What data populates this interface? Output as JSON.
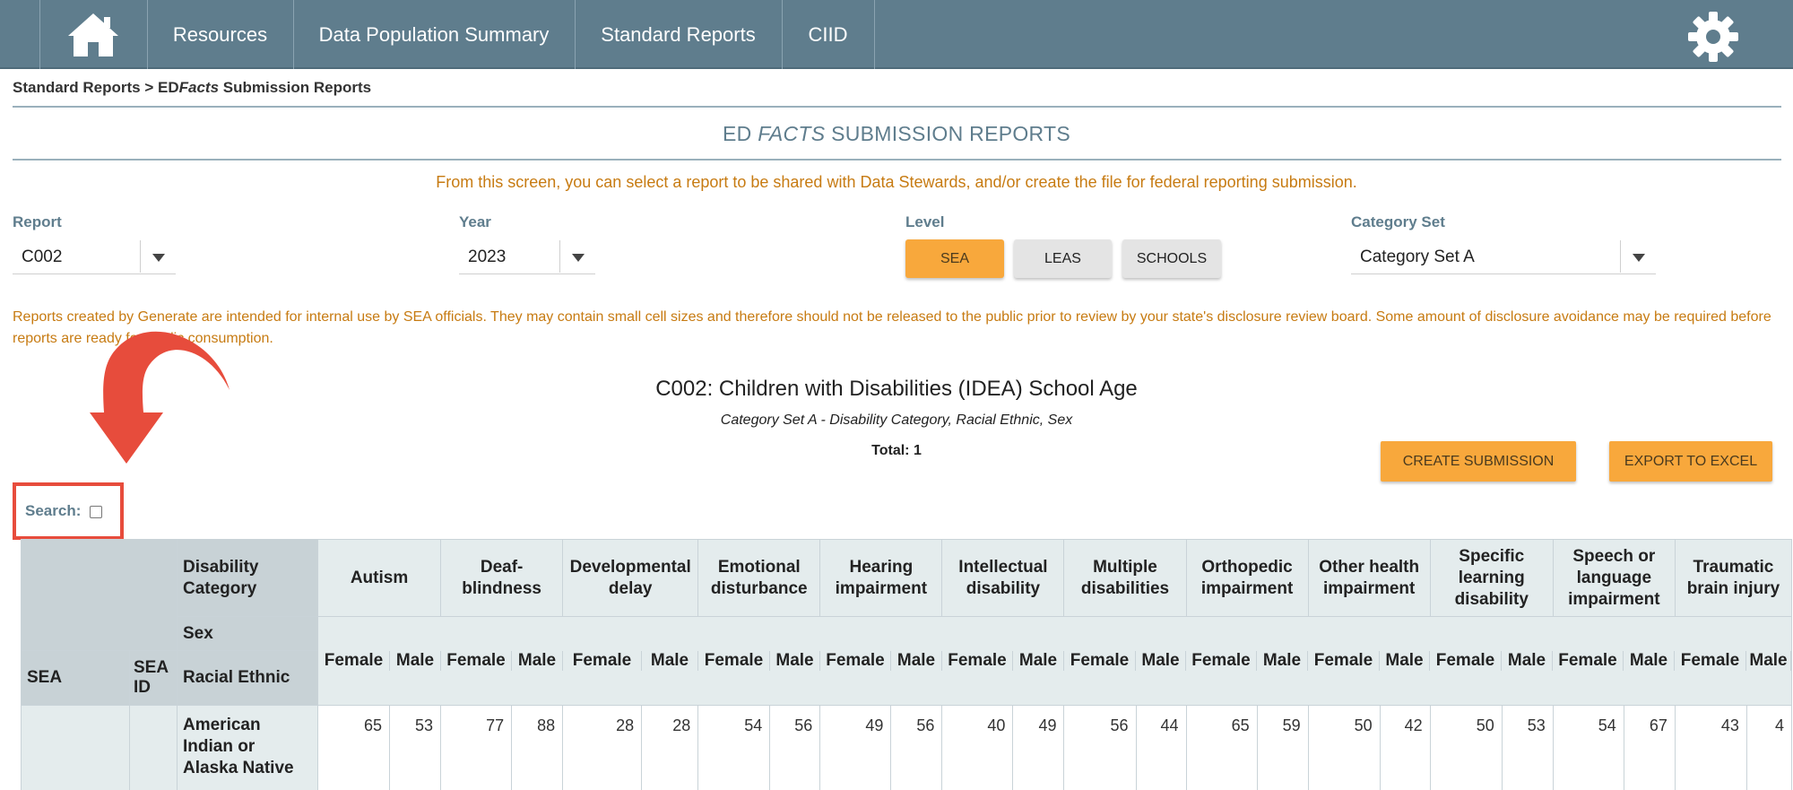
{
  "nav": {
    "items": [
      "Resources",
      "Data Population Summary",
      "Standard Reports",
      "CIID"
    ],
    "home_icon": "home-icon",
    "settings_icon": "gear-icon"
  },
  "breadcrumb": {
    "prefix": "Standard Reports > ED",
    "italic": "Facts",
    "suffix": " Submission Reports"
  },
  "page_title": {
    "prefix": "ED ",
    "italic": "FACTS",
    "suffix": " SUBMISSION REPORTS"
  },
  "intro_text": "From this screen, you can select a report to be shared with Data Stewards, and/or create the file for federal reporting submission.",
  "filters": {
    "report_label": "Report",
    "report_value": "C002",
    "year_label": "Year",
    "year_value": "2023",
    "level_label": "Level",
    "levels": [
      "SEA",
      "LEAS",
      "SCHOOLS"
    ],
    "level_selected": "SEA",
    "category_set_label": "Category Set",
    "category_set_value": "Category Set A"
  },
  "warning_text": "Reports created by Generate are intended for internal use by SEA officials. They may contain small cell sizes and therefore should not be released to the public prior to review by your state's disclosure review board. Some amount of disclosure avoidance may be required before reports are ready for public consumption.",
  "report": {
    "title": "C002: Children with Disabilities (IDEA) School Age",
    "subtitle": "Category Set A - Disability Category, Racial Ethnic, Sex",
    "total": "Total: 1"
  },
  "actions": {
    "create_submission": "CREATE SUBMISSION",
    "export_excel": "EXPORT TO EXCEL"
  },
  "search": {
    "label": "Search:",
    "checked": false
  },
  "annotation": {
    "arrow_color": "#e74c3c",
    "highlight_color": "#e74c3c"
  },
  "table": {
    "label_disability": "Disability Category",
    "label_sex": "Sex",
    "label_racial": "Racial Ethnic",
    "col_sea": "SEA",
    "col_sea_id": "SEA ID",
    "categories": [
      "Autism",
      "Deaf-blindness",
      "Developmental delay",
      "Emotional disturbance",
      "Hearing impairment",
      "Intellectual disability",
      "Multiple disabilities",
      "Orthopedic impairment",
      "Other health impairment",
      "Specific learning disability",
      "Speech or language impairment",
      "Traumatic brain injury"
    ],
    "sexes": [
      "Female",
      "Male"
    ],
    "rows": [
      {
        "sea": "",
        "sea_id": "",
        "racial": "American Indian or Alaska Native",
        "values": [
          "65",
          "53",
          "77",
          "88",
          "28",
          "28",
          "54",
          "56",
          "49",
          "56",
          "40",
          "49",
          "56",
          "44",
          "65",
          "59",
          "50",
          "42",
          "50",
          "53",
          "54",
          "67",
          "43",
          "4"
        ]
      }
    ]
  },
  "colors": {
    "nav_bg": "#5f7d8d",
    "accent": "#f8a83c",
    "orange_text": "#c77b12"
  }
}
